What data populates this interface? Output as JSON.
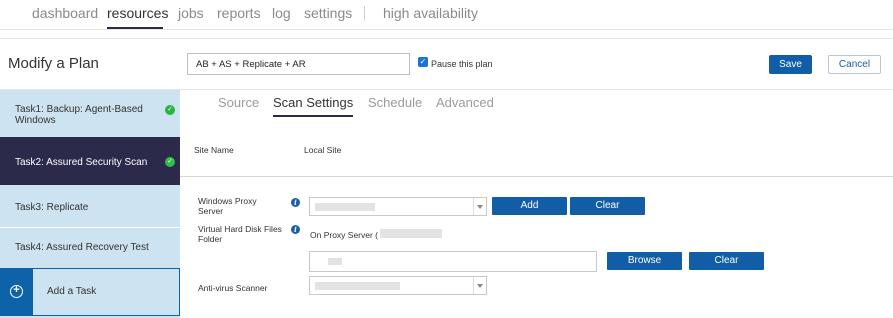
{
  "nav": {
    "items": [
      "dashboard",
      "resources",
      "jobs",
      "reports",
      "log",
      "settings",
      "high availability"
    ],
    "active": "resources"
  },
  "header": {
    "title": "Modify a Plan",
    "plan_name": "AB + AS + Replicate + AR",
    "pause_label": "Pause this plan",
    "pause_checked": true,
    "save_label": "Save",
    "cancel_label": "Cancel"
  },
  "tasks": [
    {
      "label_line1": "Task1: Backup: Agent-Based",
      "label_line2": "Windows",
      "completed": true
    },
    {
      "label_line1": "Task2: Assured Security Scan",
      "label_line2": "",
      "completed": true,
      "active": true
    },
    {
      "label_line1": "Task3: Replicate",
      "label_line2": "",
      "completed": false
    },
    {
      "label_line1": "Task4: Assured Recovery Test",
      "label_line2": "",
      "completed": false
    }
  ],
  "add_task_label": "Add a Task",
  "tabs": [
    "Source",
    "Scan Settings",
    "Schedule",
    "Advanced"
  ],
  "active_tab": "Scan Settings",
  "form": {
    "site_name_label": "Site Name",
    "site_name_value": "Local Site",
    "proxy_label_1": "Windows Proxy",
    "proxy_label_2": "Server",
    "proxy_add": "Add",
    "proxy_clear": "Clear",
    "vhd_label_1": "Virtual Hard Disk Files",
    "vhd_label_2": "Folder",
    "vhd_on_proxy": "On Proxy Server (",
    "browse": "Browse",
    "vhd_clear": "Clear",
    "av_label": "Anti-virus Scanner"
  },
  "colors": {
    "accent_dark": "#2c2a4a",
    "primary_button": "#115ea6",
    "sidebar_bg": "#cde3f1",
    "success_check": "#26b53f"
  }
}
